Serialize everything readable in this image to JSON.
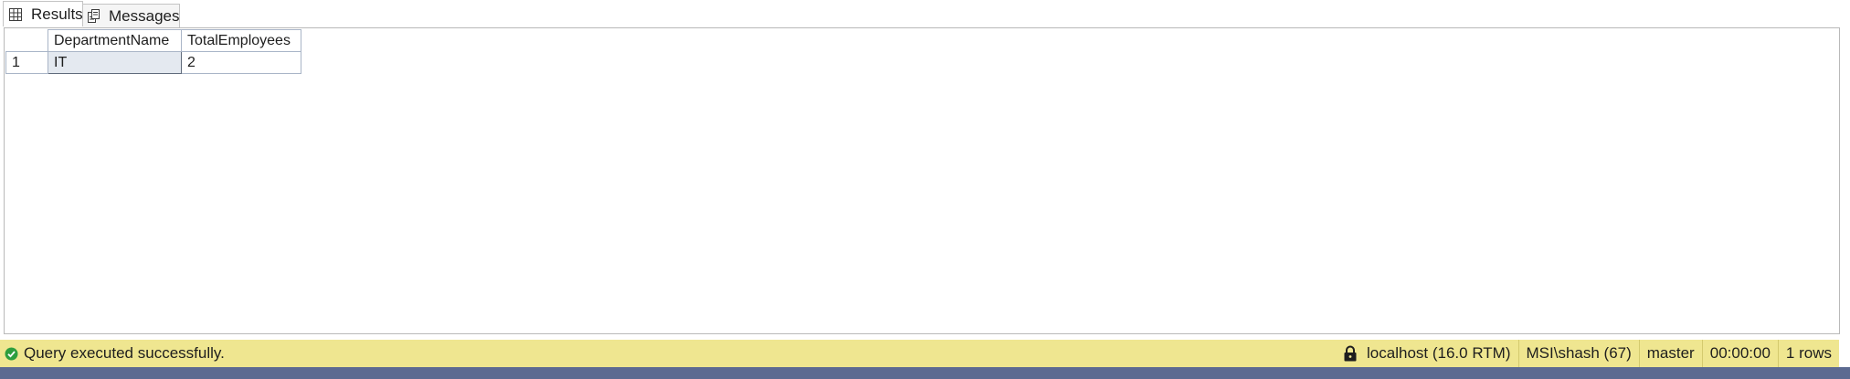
{
  "tabs": [
    {
      "label": "Results",
      "icon": "grid-icon",
      "active": true
    },
    {
      "label": "Messages",
      "icon": "messages-icon",
      "active": false
    }
  ],
  "grid": {
    "columns": [
      "DepartmentName",
      "TotalEmployees"
    ],
    "rows": [
      {
        "row_number": "1",
        "cells": [
          "IT",
          "2"
        ]
      }
    ]
  },
  "status": {
    "message": "Query executed successfully.",
    "server": "localhost (16.0 RTM)",
    "user": "MSI\\shash (67)",
    "database": "master",
    "elapsed": "00:00:00",
    "row_count": "1 rows",
    "colors": {
      "status_bar": "#efe690",
      "success": "#2e9e3e",
      "accent_bottom": "#5c6a91"
    }
  }
}
